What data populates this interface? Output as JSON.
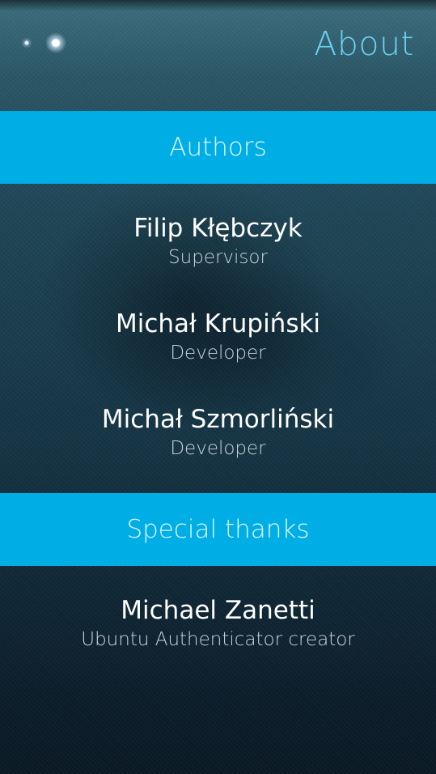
{
  "header": {
    "title": "About",
    "page_indicator": {
      "count": 2,
      "active_index": 1
    }
  },
  "sections": [
    {
      "title": "Authors",
      "people": [
        {
          "name": "Filip Kłębczyk",
          "role": "Supervisor"
        },
        {
          "name": "Michał Krupiński",
          "role": "Developer"
        },
        {
          "name": "Michał Szmorliński",
          "role": "Developer"
        }
      ]
    },
    {
      "title": "Special thanks",
      "people": [
        {
          "name": "Michael Zanetti",
          "role": "Ubuntu Authenticator creator"
        }
      ]
    }
  ],
  "colors": {
    "accent": "#00aee6",
    "title_color": "#6ad3f2",
    "background_top": "#3d6f7f",
    "background_bottom": "#0a1924"
  }
}
